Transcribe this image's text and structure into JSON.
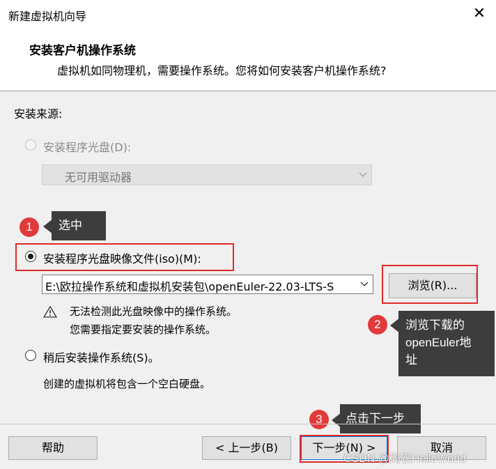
{
  "window": {
    "title": "新建虚拟机向导",
    "close_glyph": "✕"
  },
  "header": {
    "title": "安装客户机操作系统",
    "subtitle": "虚拟机如同物理机，需要操作系统。您将如何安装客户机操作系统?"
  },
  "source": {
    "label": "安装来源:",
    "disc_option": "安装程序光盘(D):",
    "drive_select_value": "无可用驱动器",
    "iso_option": "安装程序光盘映像文件(iso)(M):",
    "iso_path": "E:\\欧拉操作系统和虚拟机安装包\\openEuler-22.03-LTS-S",
    "browse_button": "浏览(R)...",
    "warning_line1": "无法检测此光盘映像中的操作系统。",
    "warning_line2": "您需要指定要安装的操作系统。",
    "later_option": "稍后安装操作系统(S)。",
    "later_desc": "创建的虚拟机将包含一个空白硬盘。"
  },
  "annotations": [
    {
      "number": "1",
      "text": "选中"
    },
    {
      "number": "2",
      "text_line1": "浏览下载的",
      "text_line2": "openEuler地",
      "text_line3": "址"
    },
    {
      "number": "3",
      "text": "点击下一步"
    }
  ],
  "footer": {
    "help_button": "帮助",
    "back_button": "< 上一步(B)",
    "next_button": "下一步(N) >",
    "cancel_button": "取消",
    "watermark": "CSDN @码农HelloWorld"
  },
  "colors": {
    "annotation_red": "#e02a2a",
    "tooltip_bg": "#3d3d3d"
  }
}
